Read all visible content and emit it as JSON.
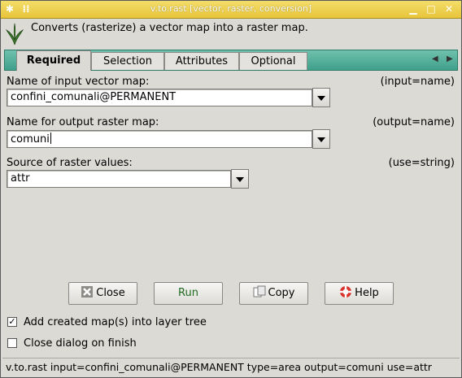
{
  "window": {
    "title": "v.to.rast [vector, raster, conversion]"
  },
  "header": {
    "description": "Converts (rasterize) a vector map into a raster map."
  },
  "tabs": [
    {
      "label": "Required"
    },
    {
      "label": "Selection"
    },
    {
      "label": "Attributes"
    },
    {
      "label": "Optional"
    }
  ],
  "fields": {
    "input": {
      "label": "Name of input vector map:",
      "param": "(input=name)",
      "value": "confini_comunali@PERMANENT"
    },
    "output": {
      "label": "Name for output raster map:",
      "param": "(output=name)",
      "value": "comuni"
    },
    "use": {
      "label": "Source of raster values:",
      "param": "(use=string)",
      "value": "attr"
    }
  },
  "buttons": {
    "close": "Close",
    "run": "Run",
    "copy": "Copy",
    "help": "Help"
  },
  "checkboxes": {
    "add_layer": {
      "label": "Add created map(s) into layer tree",
      "checked": true,
      "mark": "✓"
    },
    "close_dialog": {
      "label": "Close dialog on finish",
      "checked": false,
      "mark": ""
    }
  },
  "statusbar": {
    "command": "v.to.rast input=confini_comunali@PERMANENT type=area output=comuni use=attr"
  },
  "colors": {
    "titlebar": "#e8c53a",
    "tabstrip": "#3fa08a",
    "background": "#dcdad5"
  }
}
